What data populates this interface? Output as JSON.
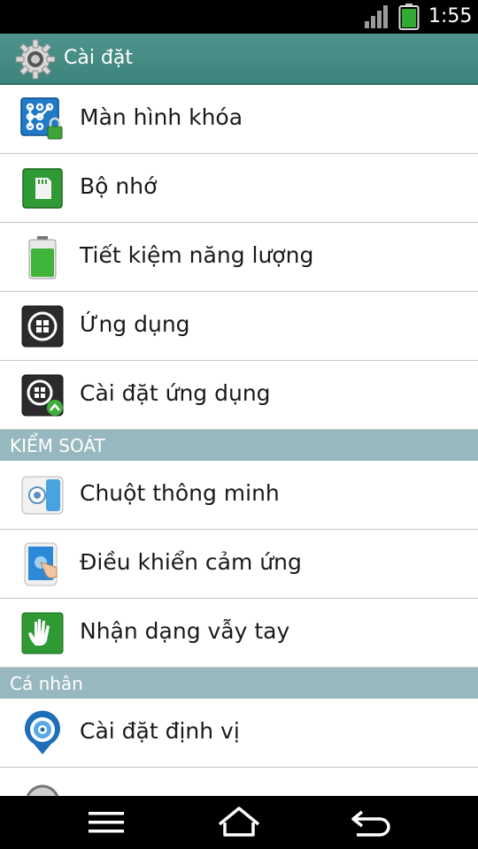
{
  "status_bar": {
    "time": "1:55",
    "icons": [
      "signal-icon",
      "battery-icon"
    ]
  },
  "action_bar": {
    "title": "Cài đặt",
    "icon": "settings-gear-icon"
  },
  "sections": [
    {
      "header": "",
      "items": [
        {
          "label": "Màn hình khóa",
          "icon": "lock-screen-icon"
        },
        {
          "label": "Bộ nhớ",
          "icon": "storage-sd-card-icon"
        },
        {
          "label": "Tiết kiệm năng lượng",
          "icon": "battery-saver-icon"
        },
        {
          "label": "Ứng dụng",
          "icon": "apps-icon"
        },
        {
          "label": "Cài đặt ứng dụng",
          "icon": "app-settings-icon"
        }
      ]
    },
    {
      "header": "KIỂM SOÁT",
      "items": [
        {
          "label": "Chuột thông minh",
          "icon": "smart-mouse-icon"
        },
        {
          "label": "Điều khiển cảm ứng",
          "icon": "touch-control-icon"
        },
        {
          "label": "Nhận dạng vẫy tay",
          "icon": "hand-wave-icon"
        }
      ]
    },
    {
      "header": "Cá nhân",
      "items": [
        {
          "label": "Cài đặt định vị",
          "icon": "location-icon"
        }
      ]
    }
  ],
  "nav_bar": {
    "buttons": [
      "menu-icon",
      "home-icon",
      "back-icon"
    ]
  },
  "colors": {
    "action_bar": "#3d847d",
    "section_header": "#97b8bf",
    "text": "#1a1a1a",
    "divider": "#c6c6c6"
  }
}
